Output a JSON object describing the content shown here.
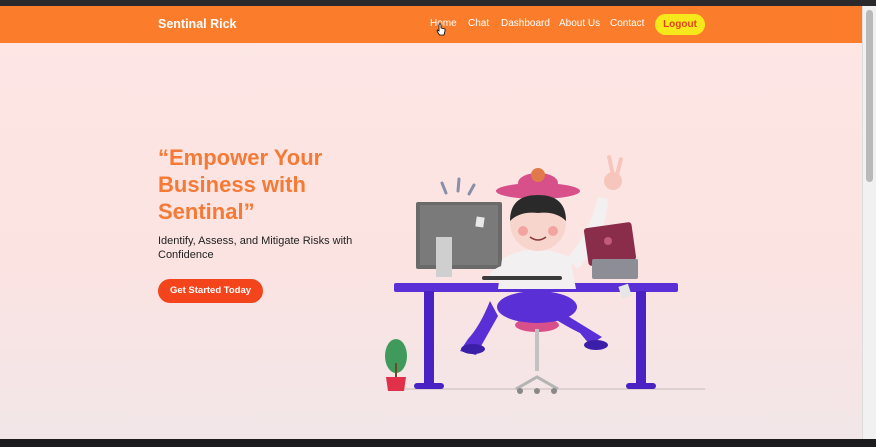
{
  "navbar": {
    "brand": "Sentinal Rick",
    "links": [
      {
        "label": "Home"
      },
      {
        "label": "Chat"
      },
      {
        "label": "Dashboard"
      },
      {
        "label": "About Us"
      },
      {
        "label": "Contact"
      }
    ],
    "logout_label": "Logout"
  },
  "hero": {
    "title": "“Empower Your Business with Sentinal”",
    "subtitle": "Identify, Assess, and Mitigate Risks with Confidence",
    "cta_label": "Get Started Today"
  },
  "colors": {
    "navbar": "#fb7d2c",
    "accent_text": "#f47a36",
    "cta": "#f4441c",
    "logout": "#f7e81c",
    "desk": "#5a2fd6"
  },
  "icons": {
    "cursor": "hand-pointer-icon"
  }
}
